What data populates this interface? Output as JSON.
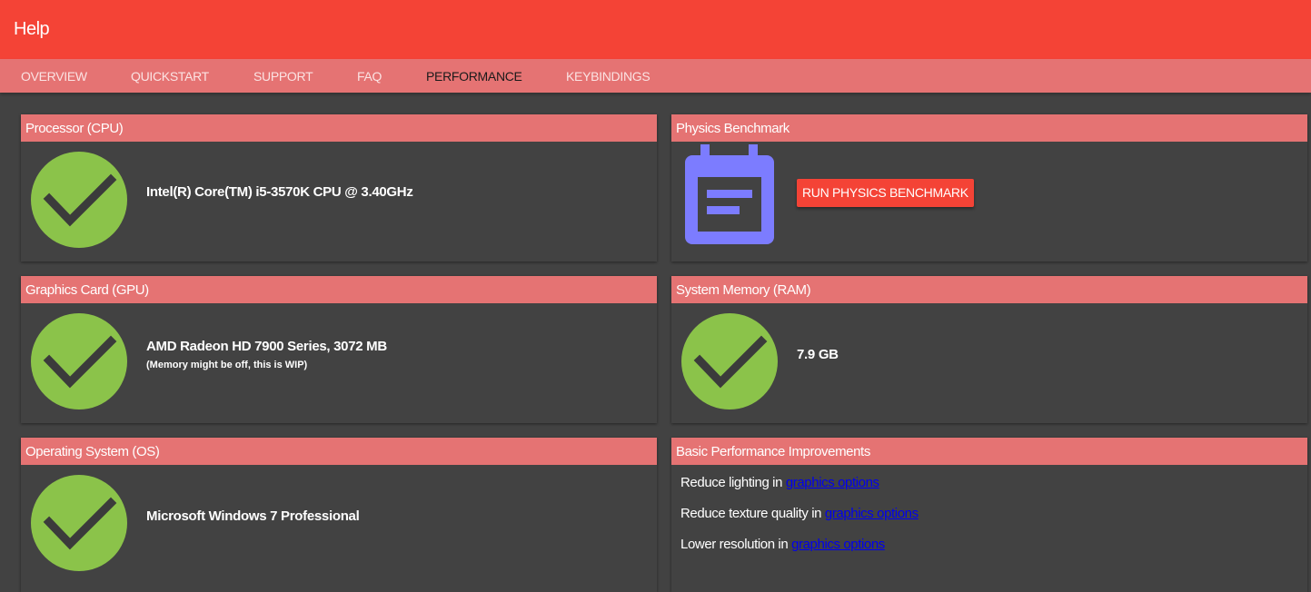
{
  "header": {
    "title": "Help"
  },
  "tabs": [
    {
      "label": "OVERVIEW"
    },
    {
      "label": "QUICKSTART"
    },
    {
      "label": "SUPPORT"
    },
    {
      "label": "FAQ"
    },
    {
      "label": "PERFORMANCE",
      "active": true
    },
    {
      "label": "KEYBINDINGS"
    }
  ],
  "cards": {
    "cpu": {
      "title": "Processor (CPU)",
      "value": "Intel(R) Core(TM) i5-3570K CPU @ 3.40GHz",
      "status_icon": "check-icon"
    },
    "gpu": {
      "title": "Graphics Card (GPU)",
      "value": "AMD Radeon HD 7900 Series, 3072 MB",
      "note": "(Memory might be off, this is WIP)",
      "status_icon": "check-icon"
    },
    "os": {
      "title": "Operating System (OS)",
      "value": "Microsoft Windows 7 Professional",
      "status_icon": "check-icon"
    },
    "physics": {
      "title": "Physics Benchmark",
      "button_label": "RUN PHYSICS BENCHMARK",
      "icon": "calendar-note-icon"
    },
    "ram": {
      "title": "System Memory (RAM)",
      "value": "7.9 GB",
      "status_icon": "check-icon"
    },
    "improvements": {
      "title": "Basic Performance Improvements",
      "tips": [
        {
          "text": "Reduce lighting in ",
          "link": "graphics options"
        },
        {
          "text": "Reduce texture quality in ",
          "link": "graphics options"
        },
        {
          "text": "Lower resolution in ",
          "link": "graphics options"
        }
      ]
    }
  },
  "colors": {
    "accent": "#f44336",
    "accent_light": "#e57373",
    "background": "#424242",
    "check_green": "#8bc34a",
    "icon_purple": "#7c7cff",
    "link": "#0000ee"
  }
}
